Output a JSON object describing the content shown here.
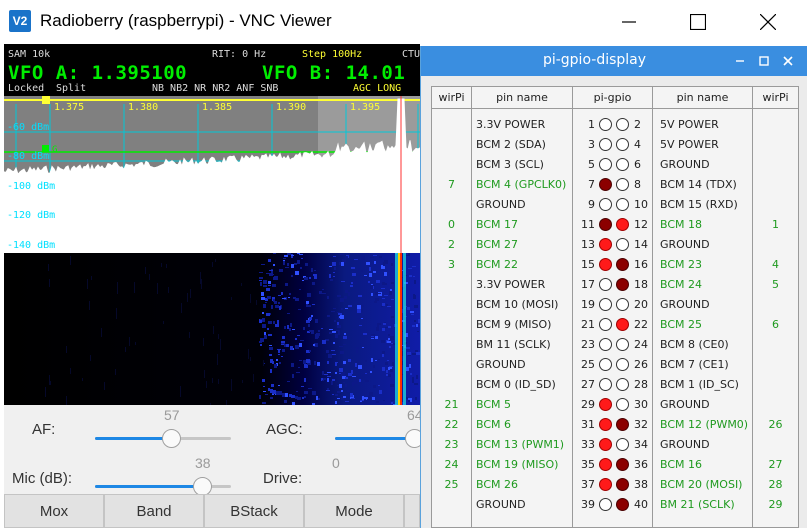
{
  "vnc_window": {
    "app_icon": "V2",
    "title": "Radioberry (raspberrypi) - VNC Viewer"
  },
  "radio": {
    "mode": "SAM 10k",
    "rit": "RIT: 0 Hz",
    "step": "Step 100Hz",
    "ctun": "CTU",
    "vfo_a": "VFO A: 1.395100",
    "vfo_b": "VFO B: 14.01",
    "locked": "Locked",
    "split": "Split",
    "flags": "NB  NB2 NR  NR2 ANF SNB",
    "agc": "AGC LONG",
    "freq_scale": [
      "1.375",
      "1.380",
      "1.385",
      "1.390",
      "1.395"
    ],
    "dbm_scale": [
      "-60 dBm",
      "-80 dBm",
      "-100 dBm",
      "-120 dBm",
      "-140 dBm"
    ],
    "marker": "G",
    "colors": {
      "vfo_green": "#00ee00",
      "agc_yellow": "#ffff33",
      "spectrum_bg": "#808080"
    }
  },
  "controls": {
    "af_label": "AF:",
    "af_value": "57",
    "agc_label": "AGC:",
    "agc_value": "64",
    "mic_label": "Mic (dB):",
    "mic_value": "38",
    "drive_label": "Drive:",
    "drive_value": "0",
    "buttons": [
      "Mox",
      "Band",
      "BStack",
      "Mode"
    ]
  },
  "gpio_window": {
    "title": "pi-gpio-display",
    "headers": {
      "wirpi_left": "wirPi",
      "pin_name_left": "pin name",
      "pi_gpio": "pi-gpio",
      "pin_name_right": "pin name",
      "wirpi_right": "wirPi"
    },
    "rows": [
      {
        "lw": "",
        "ln": "3.3V POWER",
        "lg": false,
        "lp": "1",
        "ls": "off",
        "rp": "2",
        "rs": "off",
        "rn": "5V POWER",
        "rg": false,
        "rw": ""
      },
      {
        "lw": "",
        "ln": "BCM 2 (SDA)",
        "lg": false,
        "lp": "3",
        "ls": "off",
        "rp": "4",
        "rs": "off",
        "rn": "5V POWER",
        "rg": false,
        "rw": ""
      },
      {
        "lw": "",
        "ln": "BCM 3 (SCL)",
        "lg": false,
        "lp": "5",
        "ls": "off",
        "rp": "6",
        "rs": "off",
        "rn": "GROUND",
        "rg": false,
        "rw": ""
      },
      {
        "lw": "7",
        "ln": "BCM 4 (GPCLK0)",
        "lg": true,
        "lp": "7",
        "ls": "dark",
        "rp": "8",
        "rs": "off",
        "rn": "BCM 14 (TDX)",
        "rg": false,
        "rw": ""
      },
      {
        "lw": "",
        "ln": "GROUND",
        "lg": false,
        "lp": "9",
        "ls": "off",
        "rp": "10",
        "rs": "off",
        "rn": "BCM 15 (RXD)",
        "rg": false,
        "rw": ""
      },
      {
        "lw": "0",
        "ln": "BCM 17",
        "lg": true,
        "lp": "11",
        "ls": "dark",
        "rp": "12",
        "rs": "on",
        "rn": "BCM 18",
        "rg": true,
        "rw": "1"
      },
      {
        "lw": "2",
        "ln": "BCM 27",
        "lg": true,
        "lp": "13",
        "ls": "on",
        "rp": "14",
        "rs": "off",
        "rn": "GROUND",
        "rg": false,
        "rw": ""
      },
      {
        "lw": "3",
        "ln": "BCM 22",
        "lg": true,
        "lp": "15",
        "ls": "on",
        "rp": "16",
        "rs": "dark",
        "rn": "BCM 23",
        "rg": true,
        "rw": "4"
      },
      {
        "lw": "",
        "ln": "3.3V POWER",
        "lg": false,
        "lp": "17",
        "ls": "off",
        "rp": "18",
        "rs": "dark",
        "rn": "BCM 24",
        "rg": true,
        "rw": "5"
      },
      {
        "lw": "",
        "ln": "BCM 10 (MOSI)",
        "lg": false,
        "lp": "19",
        "ls": "off",
        "rp": "20",
        "rs": "off",
        "rn": "GROUND",
        "rg": false,
        "rw": ""
      },
      {
        "lw": "",
        "ln": "BCM 9 (MISO)",
        "lg": false,
        "lp": "21",
        "ls": "off",
        "rp": "22",
        "rs": "on",
        "rn": "BCM 25",
        "rg": true,
        "rw": "6"
      },
      {
        "lw": "",
        "ln": "BM 11 (SCLK)",
        "lg": false,
        "lp": "23",
        "ls": "off",
        "rp": "24",
        "rs": "off",
        "rn": "BCM 8 (CE0)",
        "rg": false,
        "rw": ""
      },
      {
        "lw": "",
        "ln": "GROUND",
        "lg": false,
        "lp": "25",
        "ls": "off",
        "rp": "26",
        "rs": "off",
        "rn": "BCM 7 (CE1)",
        "rg": false,
        "rw": ""
      },
      {
        "lw": "",
        "ln": "BCM 0 (ID_SD)",
        "lg": false,
        "lp": "27",
        "ls": "off",
        "rp": "28",
        "rs": "off",
        "rn": "BCM 1 (ID_SC)",
        "rg": false,
        "rw": ""
      },
      {
        "lw": "21",
        "ln": "BCM 5",
        "lg": true,
        "lp": "29",
        "ls": "on",
        "rp": "30",
        "rs": "off",
        "rn": "GROUND",
        "rg": false,
        "rw": ""
      },
      {
        "lw": "22",
        "ln": "BCM 6",
        "lg": true,
        "lp": "31",
        "ls": "on",
        "rp": "32",
        "rs": "dark",
        "rn": "BCM 12 (PWM0)",
        "rg": true,
        "rw": "26"
      },
      {
        "lw": "23",
        "ln": "BCM 13 (PWM1)",
        "lg": true,
        "lp": "33",
        "ls": "on",
        "rp": "34",
        "rs": "off",
        "rn": "GROUND",
        "rg": false,
        "rw": ""
      },
      {
        "lw": "24",
        "ln": "BCM 19 (MISO)",
        "lg": true,
        "lp": "35",
        "ls": "on",
        "rp": "36",
        "rs": "dark",
        "rn": "BCM 16",
        "rg": true,
        "rw": "27"
      },
      {
        "lw": "25",
        "ln": "BCM 26",
        "lg": true,
        "lp": "37",
        "ls": "on",
        "rp": "38",
        "rs": "dark",
        "rn": "BCM 20 (MOSI)",
        "rg": true,
        "rw": "28"
      },
      {
        "lw": "",
        "ln": "GROUND",
        "lg": false,
        "lp": "39",
        "ls": "off",
        "rp": "40",
        "rs": "dark",
        "rn": "BM 21 (SCLK)",
        "rg": true,
        "rw": "29"
      }
    ]
  }
}
